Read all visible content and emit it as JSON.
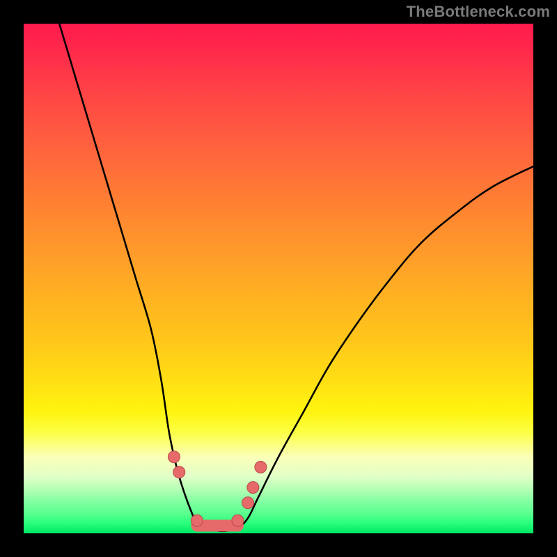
{
  "watermark": "TheBottleneck.com",
  "colors": {
    "frame": "#000000",
    "curve_stroke": "#000000",
    "dot_fill": "#e66a6a",
    "dot_stroke": "#b84a4a"
  },
  "chart_data": {
    "type": "line",
    "title": "",
    "xlabel": "",
    "ylabel": "",
    "xlim": [
      0,
      100
    ],
    "ylim": [
      0,
      100
    ],
    "grid": false,
    "legend": false,
    "note": "Bottleneck V-curve. X = component balance axis (arbitrary 0–100). Y = bottleneck severity 0 (green, optimal) to 100 (red, severe). Values estimated from pixel positions.",
    "series": [
      {
        "name": "left-branch",
        "x": [
          7,
          10,
          13,
          16,
          19,
          22,
          25,
          27,
          28.5,
          30,
          31.5,
          33,
          34
        ],
        "y": [
          100,
          90,
          80,
          70,
          60,
          50,
          40,
          30,
          20,
          13,
          8,
          4,
          2
        ]
      },
      {
        "name": "valley",
        "x": [
          34,
          36,
          38,
          40,
          42,
          44
        ],
        "y": [
          2,
          1,
          0.5,
          0.5,
          1,
          3
        ]
      },
      {
        "name": "right-branch",
        "x": [
          44,
          46,
          50,
          55,
          60,
          66,
          72,
          78,
          85,
          92,
          100
        ],
        "y": [
          3,
          7,
          15,
          24,
          33,
          42,
          50,
          57,
          63,
          68,
          72
        ]
      }
    ],
    "markers": [
      {
        "name": "left-dot-upper",
        "x": 29.5,
        "y": 15
      },
      {
        "name": "left-dot-lower",
        "x": 30.5,
        "y": 12
      },
      {
        "name": "valley-dot-1",
        "x": 34,
        "y": 2.5
      },
      {
        "name": "valley-dot-3",
        "x": 42,
        "y": 2.5
      },
      {
        "name": "right-dot-lower",
        "x": 44,
        "y": 6
      },
      {
        "name": "right-dot-mid",
        "x": 45,
        "y": 9
      },
      {
        "name": "right-dot-upper",
        "x": 46.5,
        "y": 13
      }
    ],
    "valley_bar": {
      "x0": 34,
      "x1": 42,
      "y": 1.5
    }
  }
}
